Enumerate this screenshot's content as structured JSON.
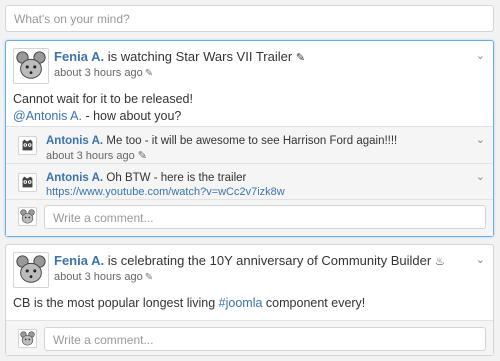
{
  "composer": {
    "placeholder": "What's on your mind?"
  },
  "posts": [
    {
      "author": "Fenia A.",
      "action": "is watching Star Wars VII Trailer",
      "action_icon": "film-icon",
      "time": "about 3 hours ago",
      "body_line1": "Cannot wait for it to be released!",
      "mention": "@Antonis A.",
      "body_line2_rest": " - how about you?",
      "comments": [
        {
          "author": "Antonis A.",
          "text": "Me too - it will be awesome to see Harrison Ford again!!!!",
          "time": "about 3 hours ago"
        },
        {
          "author": "Antonis A.",
          "text": "Oh BTW - here is the trailer",
          "link": "https://www.youtube.com/watch?v=wCc2v7izk8w"
        }
      ],
      "comment_placeholder": "Write a comment..."
    },
    {
      "author": "Fenia A.",
      "action": "is celebrating the 10Y anniversary of Community Builder",
      "action_icon": "cake-icon",
      "time": "about 3 hours ago",
      "body_pre": "CB is the most popular longest living ",
      "hashtag": "#joomla",
      "body_post": " component every!",
      "comment_placeholder": "Write a comment..."
    }
  ]
}
